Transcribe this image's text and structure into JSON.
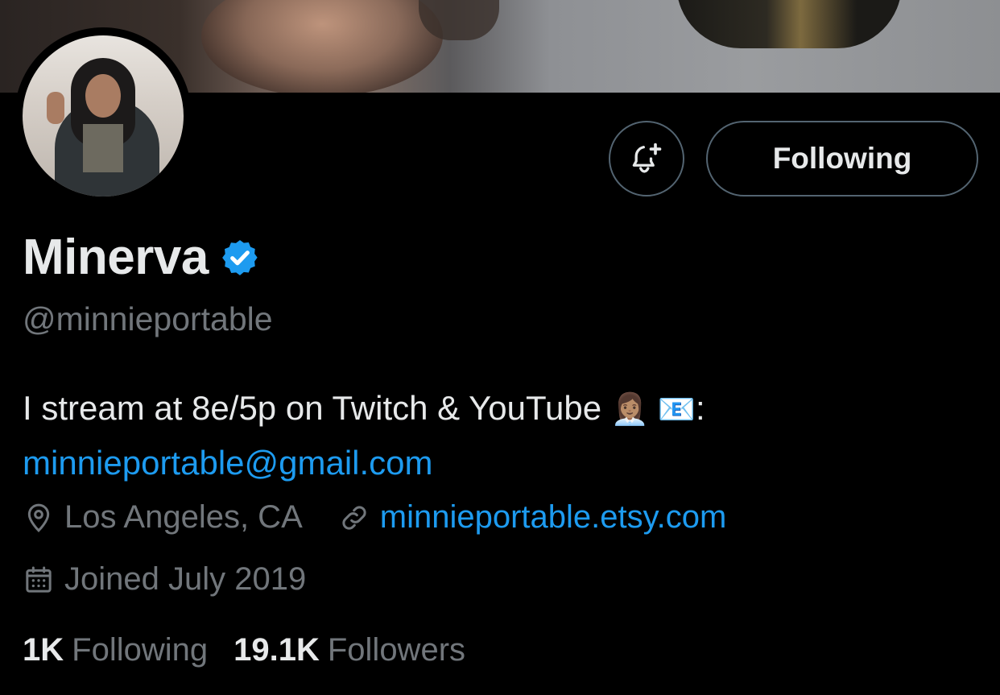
{
  "profile": {
    "name": "Minerva",
    "handle": "@minnieportable",
    "bio_text": "I stream at 8e/5p on Twitch & YouTube",
    "bio_emoji": "👩🏽‍💼 📧",
    "bio_colon": ":",
    "email": "minnieportable@gmail.com",
    "location": "Los Angeles, CA",
    "website": "minnieportable.etsy.com",
    "joined": "Joined July 2019"
  },
  "actions": {
    "follow_label": "Following",
    "bell_icon": "bell-plus-icon"
  },
  "stats": {
    "following_count": "1K",
    "following_label": "Following",
    "followers_count": "19.1K",
    "followers_label": "Followers"
  },
  "colors": {
    "accent": "#1d9bf0",
    "muted": "#71767b",
    "text": "#e7e9ea",
    "background": "#000000",
    "border": "#536471"
  }
}
